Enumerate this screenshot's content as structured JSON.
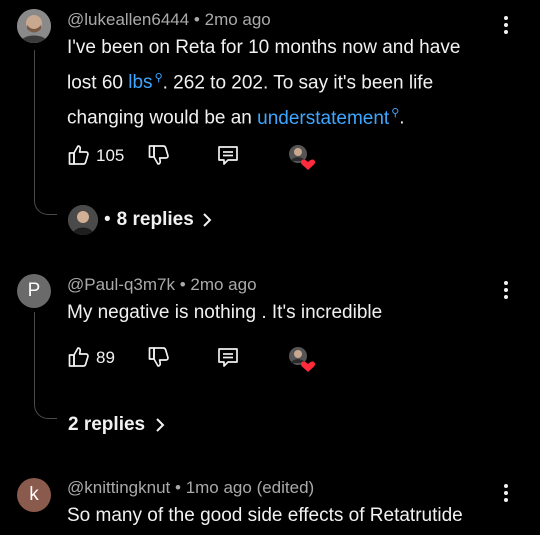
{
  "comments": [
    {
      "author": "@lukeallen6444",
      "time": "2mo ago",
      "text_line1": "I've been on Reta for 10 months now and have",
      "text_line2_pre": "lost 60 ",
      "text_line2_link": "lbs",
      "text_line2_post": ". 262 to 202. To say it's been life",
      "text_line3_pre": "changing would be an ",
      "text_line3_link": "understatement",
      "text_line3_post": ".",
      "likes": "105",
      "replies": "8 replies",
      "replies_sep": "•"
    },
    {
      "author": "@Paul-q3m7k",
      "time": "2mo ago",
      "avatar_letter": "P",
      "avatar_color": "#6a6a6a",
      "text": "My negative is nothing . It's incredible",
      "likes": "89",
      "replies": "2 replies"
    },
    {
      "author": "@knittingknut",
      "time": "1mo ago (edited)",
      "avatar_letter": "k",
      "avatar_color": "#8a5a4c",
      "text": "So many of the good side effects of Retatrutide"
    }
  ],
  "meta_separator": "•",
  "icons": [
    "like-icon",
    "dislike-icon",
    "reply-icon",
    "creator-heart-icon",
    "search-icon",
    "chevron-right-icon",
    "more-icon"
  ]
}
